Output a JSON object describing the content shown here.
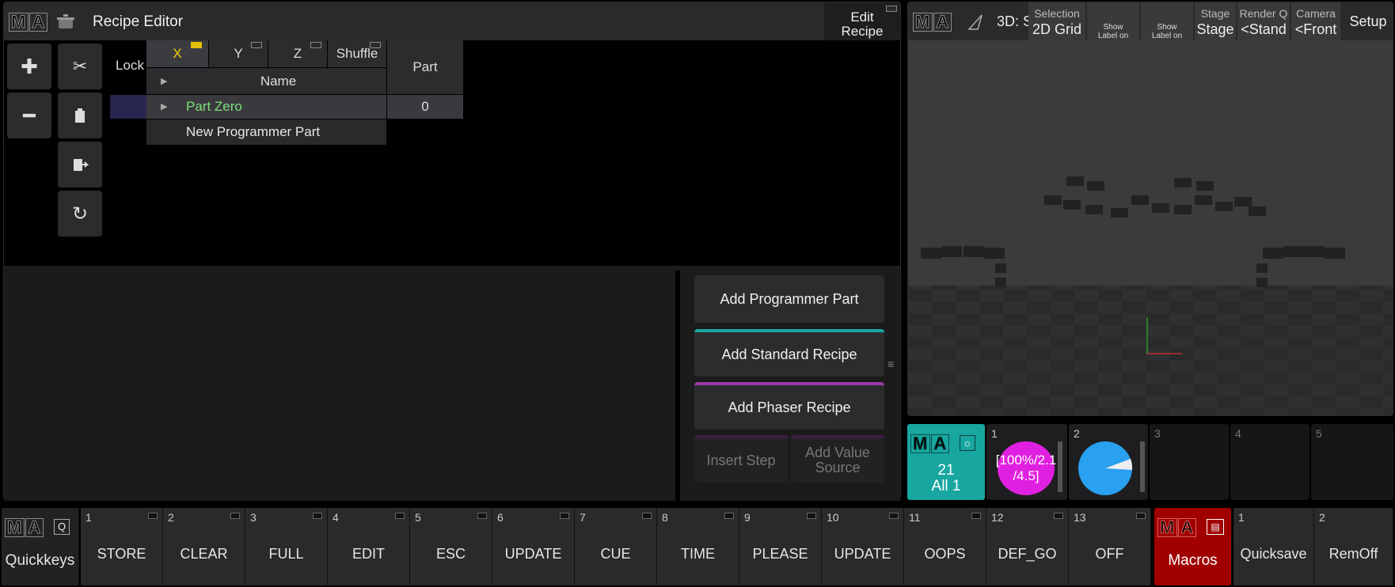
{
  "recipe_editor": {
    "title": "Recipe Editor",
    "edit_recipe_label": "Edit\nRecipe",
    "table": {
      "lock_header": "Lock",
      "axis_tabs": [
        "X",
        "Y",
        "Z",
        "Shuffle"
      ],
      "name_header": "Name",
      "part_header": "Part",
      "rows": [
        {
          "name": "Part Zero",
          "part": "0"
        },
        {
          "name": "New Programmer Part",
          "part": ""
        }
      ]
    },
    "buttons": {
      "add_programmer_part": "Add Programmer Part",
      "add_standard_recipe": "Add Standard Recipe",
      "add_phaser_recipe": "Add Phaser Recipe",
      "insert_step": "Insert Step",
      "add_value_source": "Add Value\nSource"
    }
  },
  "viewer": {
    "title": "3D: S",
    "headers": [
      {
        "sub": "Selection",
        "value": "2D Grid"
      },
      {
        "sub": "",
        "value": "Show\nLabel on\nSpot"
      },
      {
        "sub": "",
        "value": "Show\nLabel on\nBody"
      },
      {
        "sub": "Stage",
        "value": "Stage"
      },
      {
        "sub": "Render Q",
        "value": "<Stand"
      },
      {
        "sub": "Camera",
        "value": "<Front"
      },
      {
        "sub": "",
        "value": "Setup"
      }
    ]
  },
  "pools": {
    "main": {
      "number": "21",
      "label": "All 1"
    },
    "items": [
      {
        "number": "1",
        "text": "[100%/2.1\n/4.5]",
        "color": "#e020e0"
      },
      {
        "number": "2",
        "text": "",
        "color": "#2aa0f0"
      },
      {
        "number": "3",
        "text": ""
      },
      {
        "number": "4",
        "text": ""
      },
      {
        "number": "5",
        "text": ""
      }
    ]
  },
  "quickkeys": {
    "pool_label": "Quickkeys",
    "keys": [
      {
        "number": "1",
        "label": "STORE"
      },
      {
        "number": "2",
        "label": "CLEAR"
      },
      {
        "number": "3",
        "label": "FULL"
      },
      {
        "number": "4",
        "label": "EDIT"
      },
      {
        "number": "5",
        "label": "ESC"
      },
      {
        "number": "6",
        "label": "UPDATE"
      },
      {
        "number": "7",
        "label": "CUE"
      },
      {
        "number": "8",
        "label": "TIME"
      },
      {
        "number": "9",
        "label": "PLEASE"
      },
      {
        "number": "10",
        "label": "UPDATE"
      },
      {
        "number": "11",
        "label": "OOPS"
      },
      {
        "number": "12",
        "label": "DEF_GO"
      },
      {
        "number": "13",
        "label": "OFF"
      }
    ]
  },
  "macros": {
    "pool_label": "Macros",
    "keys": [
      {
        "number": "1",
        "label": "Quicksave"
      },
      {
        "number": "2",
        "label": "RemOff"
      }
    ]
  },
  "colors": {
    "accent_teal": "#18a6a0",
    "macro_red": "#a00000",
    "highlight_green": "#7ce07c",
    "selected_x": "#f0d000"
  }
}
